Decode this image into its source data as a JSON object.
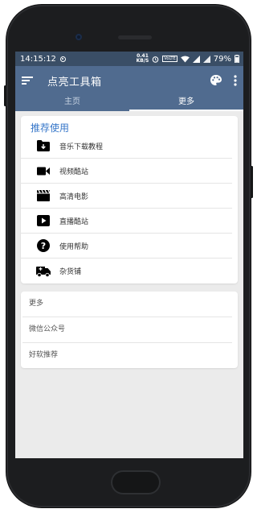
{
  "status_bar": {
    "time": "14:15:12",
    "speed_value": "0.41",
    "speed_unit": "KB/S",
    "volte": "VoLTE",
    "battery": "79%"
  },
  "app_bar": {
    "title": "点亮工具箱"
  },
  "tabs": [
    {
      "label": "主页",
      "active": false
    },
    {
      "label": "更多",
      "active": true
    }
  ],
  "recommend": {
    "title": "推荐使用",
    "items": [
      {
        "label": "音乐下载教程",
        "icon": "folder-download-icon"
      },
      {
        "label": "视频酷站",
        "icon": "video-camera-icon"
      },
      {
        "label": "高清电影",
        "icon": "movie-clapper-icon"
      },
      {
        "label": "直播酷站",
        "icon": "play-box-icon"
      },
      {
        "label": "使用帮助",
        "icon": "help-circle-icon"
      },
      {
        "label": "杂货铺",
        "icon": "ambulance-icon"
      }
    ]
  },
  "more": {
    "items": [
      {
        "label": "更多"
      },
      {
        "label": "微信公众号"
      },
      {
        "label": "好软推荐"
      }
    ]
  },
  "colors": {
    "status_bar": "#3a4e66",
    "app_bar": "#506b8f",
    "accent_title": "#3777c9",
    "background": "#ebebeb"
  }
}
